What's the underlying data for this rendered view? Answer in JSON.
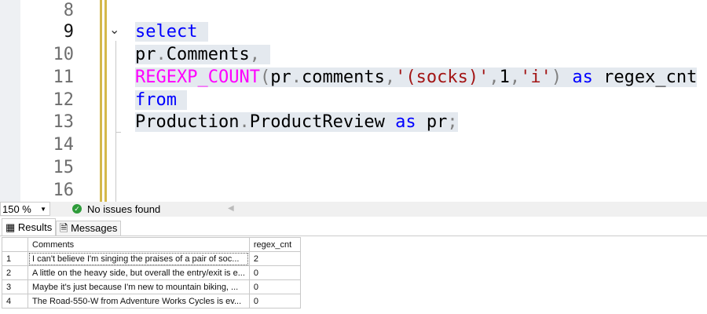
{
  "editor": {
    "line_numbers": [
      "8",
      "9",
      "10",
      "11",
      "12",
      "13",
      "14",
      "15",
      "16"
    ],
    "current_line": "9",
    "code": {
      "l9": "select",
      "l10a": "pr",
      "l10b": ".",
      "l10c": "Comments",
      "l10d": ",",
      "l11a": "REGEXP_COUNT",
      "l11b": "(",
      "l11c": "pr",
      "l11d": ".",
      "l11e": "comments",
      "l11f": ",",
      "l11g": "'(socks)'",
      "l11h": ",",
      "l11i": "1",
      "l11j": ",",
      "l11k": "'i'",
      "l11l": ")",
      "l11m": "as",
      "l11n": "regex_cnt",
      "l12": "from",
      "l13a": "Production",
      "l13b": ".",
      "l13c": "ProductReview",
      "l13d": "as",
      "l13e": "pr",
      "l13f": ";"
    }
  },
  "status": {
    "zoom": "150 %",
    "issues": "No issues found"
  },
  "tabs": {
    "results": "Results",
    "messages": "Messages"
  },
  "grid": {
    "columns": [
      "Comments",
      "regex_cnt"
    ],
    "rows": [
      {
        "n": "1",
        "comments": "I can't believe I'm singing the praises of a pair of soc...",
        "cnt": "2"
      },
      {
        "n": "2",
        "comments": "A little on the heavy side, but overall the entry/exit is e...",
        "cnt": "0"
      },
      {
        "n": "3",
        "comments": "Maybe it's just because I'm new to mountain biking, ...",
        "cnt": "0"
      },
      {
        "n": "4",
        "comments": "The Road-550-W from Adventure Works Cycles is ev...",
        "cnt": "0"
      }
    ]
  }
}
